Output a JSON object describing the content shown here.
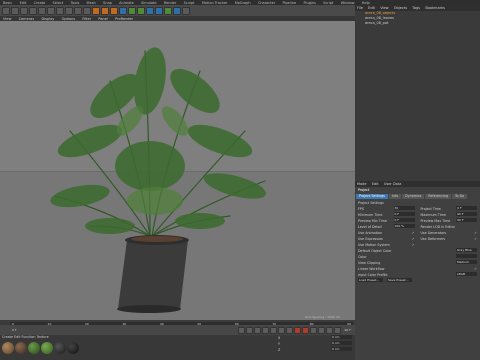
{
  "menubar": {
    "items": [
      "Basic",
      "Edit",
      "Create",
      "Select",
      "Tools",
      "Mesh",
      "Snap",
      "Animate",
      "Simulate",
      "Render",
      "Sculpt",
      "Motion Tracker",
      "MoGraph",
      "Character",
      "Pipeline",
      "Plugins",
      "Script",
      "Window",
      "Help"
    ]
  },
  "viewport_menu": {
    "items": [
      "View",
      "Cameras",
      "Display",
      "Options",
      "Filter",
      "Panel",
      "ProRender"
    ]
  },
  "object_manager": {
    "tabs": [
      "File",
      "Edit",
      "View",
      "Objects",
      "Tags",
      "Bookmarks"
    ],
    "objects": [
      {
        "label": "areca_08_objects",
        "selected": true
      },
      {
        "label": "areca_08_leaves",
        "selected": false
      },
      {
        "label": "areca_08_pot",
        "selected": false
      }
    ]
  },
  "attribute_manager": {
    "menu": [
      "Mode",
      "Edit",
      "User Data"
    ],
    "title": "Project",
    "tabs": [
      "Project Settings",
      "Info",
      "Dynamics",
      "Referencing",
      "To Do",
      "Key Interpolation"
    ],
    "section": "Project Settings",
    "rows_left": [
      {
        "label": "FPS",
        "value": "30"
      },
      {
        "label": "Minimum Time",
        "value": "0 F"
      },
      {
        "label": "Preview Min Time",
        "value": "0 F"
      },
      {
        "label": "Level of Detail",
        "value": "100 %"
      },
      {
        "label": "Use Animation",
        "value": "✓"
      },
      {
        "label": "Use Expression",
        "value": "✓"
      },
      {
        "label": "Use Motion System",
        "value": "✓"
      }
    ],
    "rows_right": [
      {
        "label": "Project Time",
        "value": "0 F"
      },
      {
        "label": "Maximum Time",
        "value": "90 F"
      },
      {
        "label": "Preview Max Time",
        "value": "90 F"
      },
      {
        "label": "Render LOD in Editor",
        "value": ""
      },
      {
        "label": "Use Generators",
        "value": "✓"
      },
      {
        "label": "Use Deformers",
        "value": "✓"
      }
    ],
    "default_object_color_label": "Default Object Color",
    "default_object_color_value": "Gray Blue",
    "color_label": "Color",
    "view_clipping_label": "View Clipping",
    "view_clipping_value": "Medium",
    "linear_workflow_label": "Linear Workflow",
    "input_color_profile_label": "Input Color Profile",
    "input_color_profile_value": "sRGB",
    "load_preset_label": "Load Preset...",
    "save_preset_label": "Save Preset..."
  },
  "timeline": {
    "ticks": [
      "0",
      "5",
      "10",
      "15",
      "20",
      "25",
      "30",
      "35",
      "40",
      "45",
      "50",
      "55",
      "60",
      "65",
      "70",
      "75",
      "80",
      "85",
      "90"
    ],
    "current_frame": "0 F",
    "end_frame": "90 F"
  },
  "status": {
    "grid_spacing": "Grid Spacing : 1000 cm"
  },
  "materials": {
    "menu": [
      "Create",
      "Edit",
      "Function",
      "Texture"
    ],
    "swatches": [
      {
        "name": "pot",
        "color": "#8a6a4a"
      },
      {
        "name": "soil",
        "color": "#5a4030"
      },
      {
        "name": "leaf1",
        "color": "#3f6a2a"
      },
      {
        "name": "leaf2",
        "color": "#4e7a30"
      },
      {
        "name": "stem",
        "color": "#2f2f2f"
      },
      {
        "name": "dark",
        "color": "#252525"
      }
    ]
  },
  "coords": {
    "x": "0 cm",
    "y": "0 cm",
    "z": "0 cm"
  }
}
